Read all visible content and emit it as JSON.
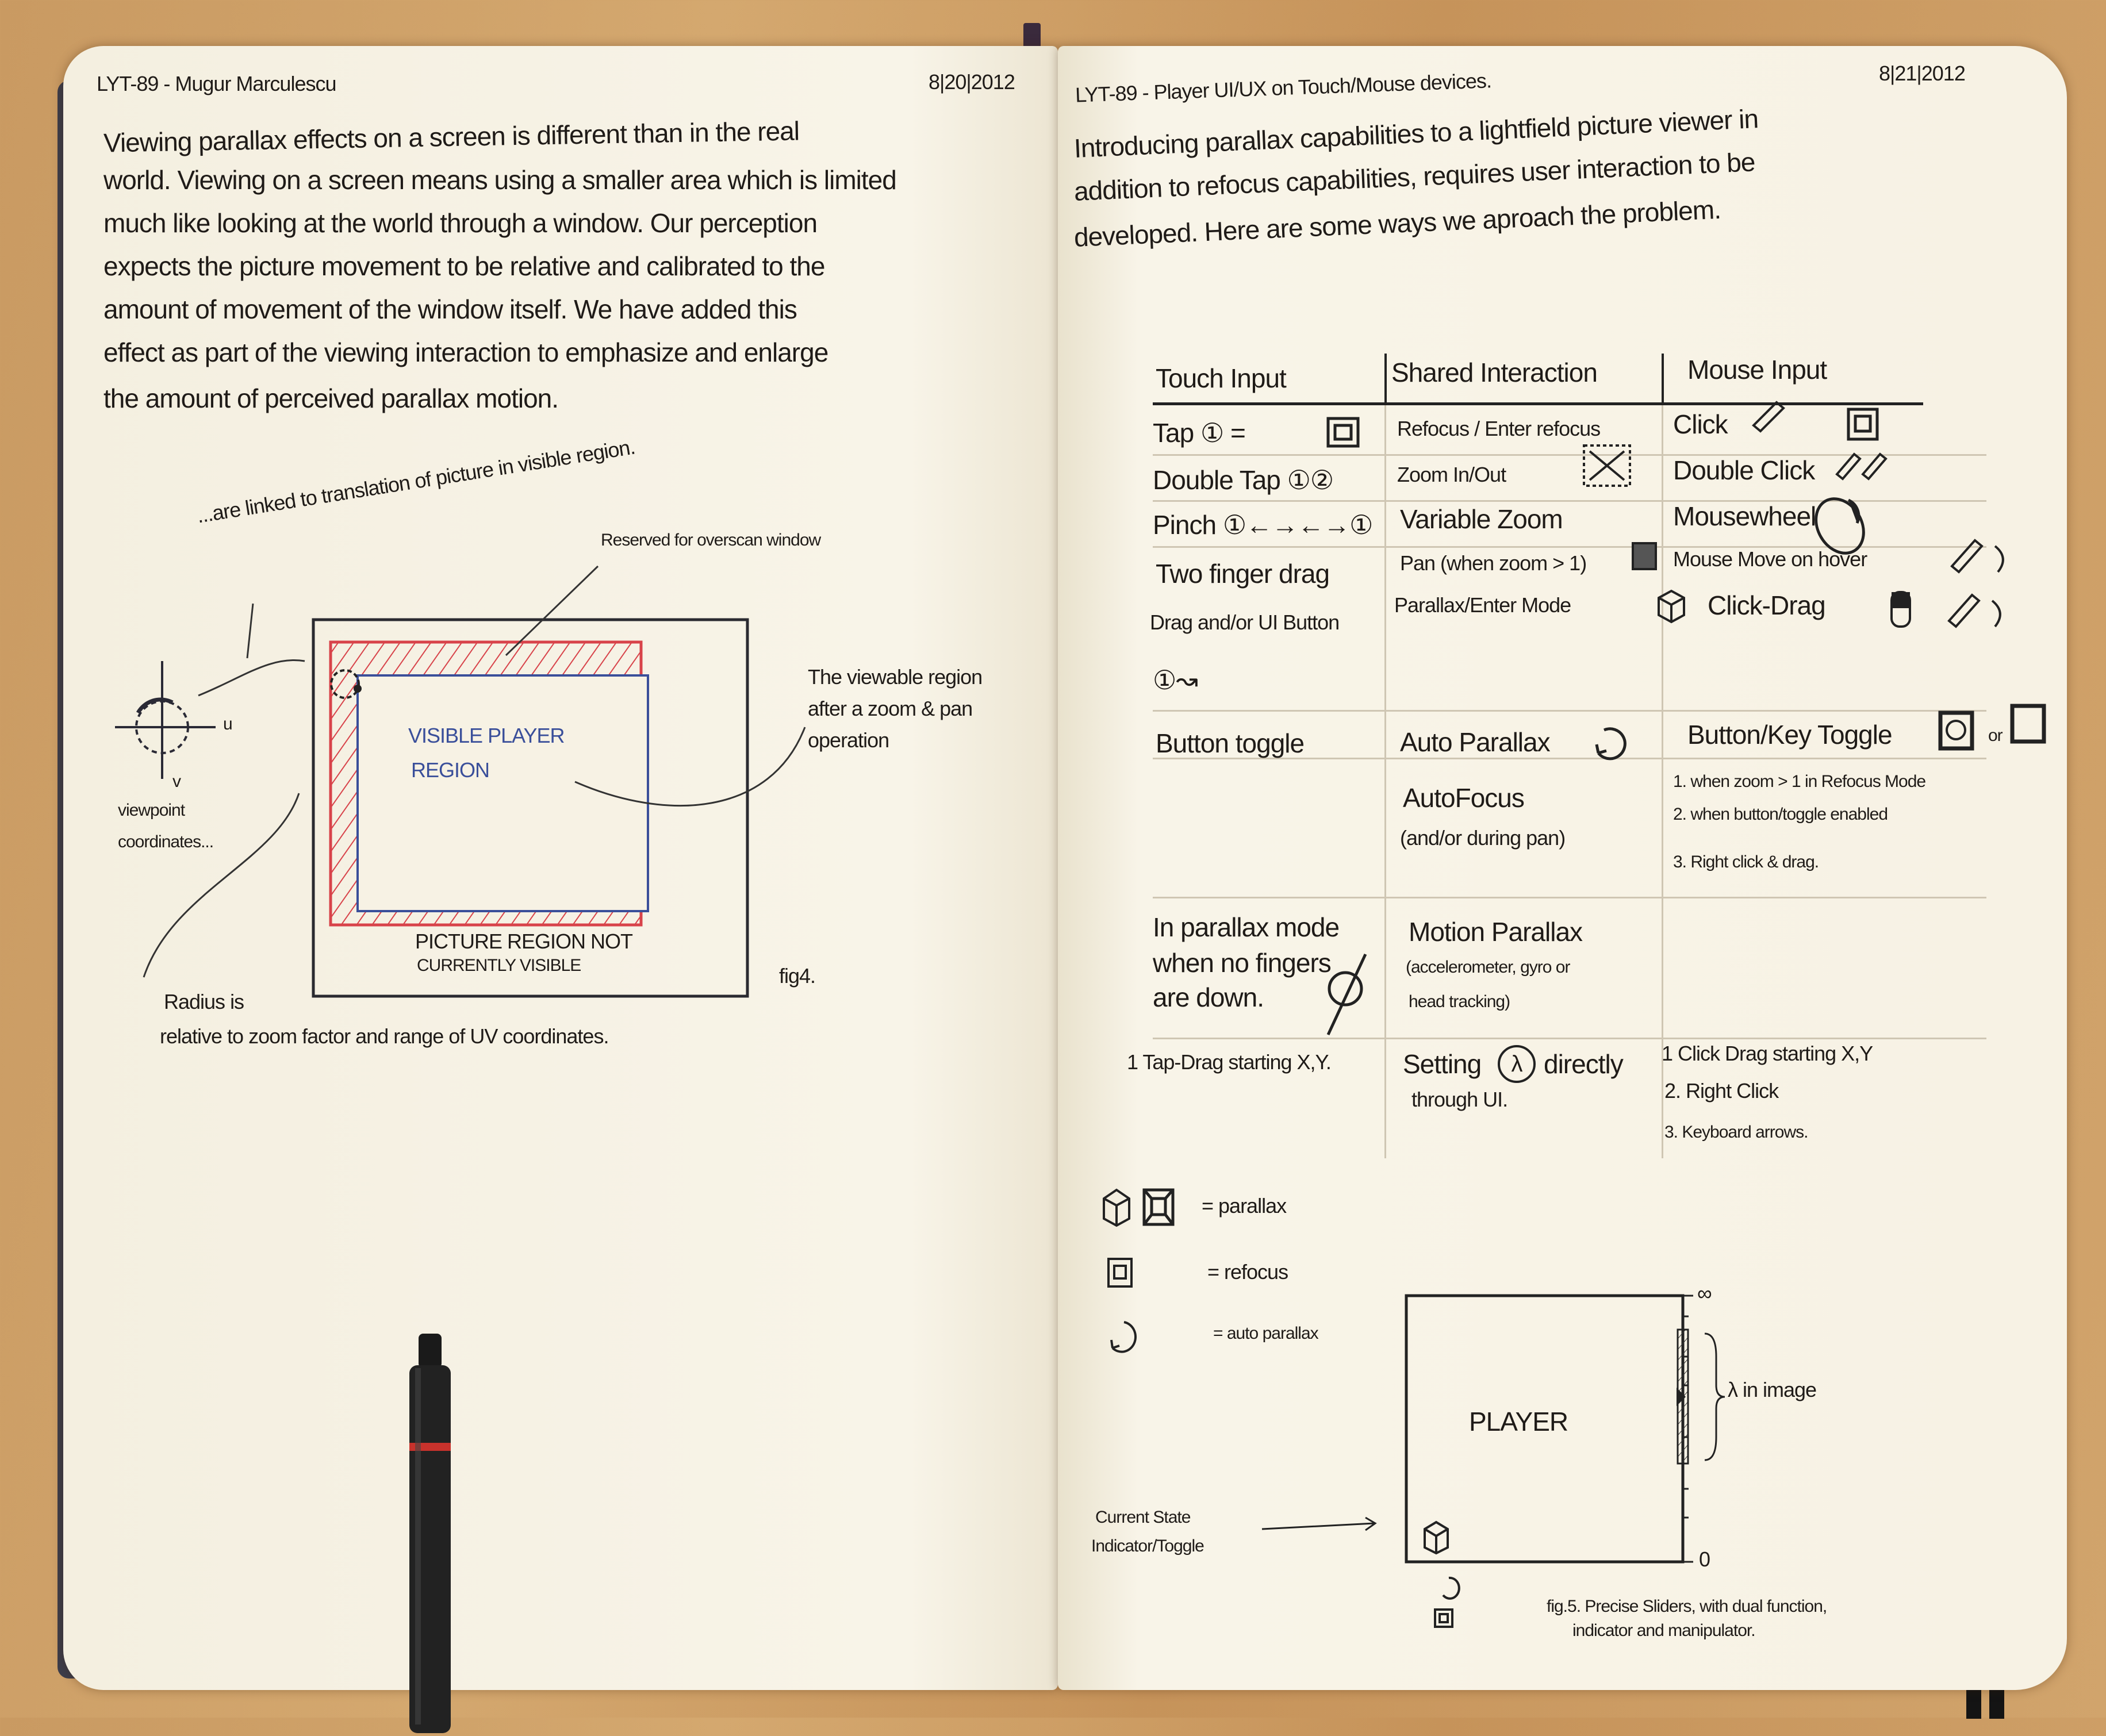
{
  "left_page": {
    "header": {
      "title": "LYT-89 - Mugur Marculescu",
      "date": "8|20|2012"
    },
    "paragraph_lines": [
      "Viewing parallax effects on a screen is different than in the real",
      "world. Viewing on a screen means using a smaller area which is limited",
      "much like looking at the world through a window. Our perception",
      "expects the picture movement to be relative and calibrated to the",
      "amount of movement of the window itself. We have added this",
      "effect as part of the viewing interaction to emphasize and enlarge",
      "the amount of perceived parallax motion."
    ],
    "figure4": {
      "linked_note": "...are linked to translation of picture in visible region.",
      "overscan_label": "Reserved for overscan window",
      "visible_region_lines": [
        "VISIBLE PLAYER",
        "REGION"
      ],
      "not_visible_lines": [
        "PICTURE REGION NOT",
        "CURRENTLY VISIBLE"
      ],
      "viewable_note_lines": [
        "The viewable region",
        "after a zoom & pan",
        "operation"
      ],
      "fig_label": "fig4.",
      "axis_u": "u",
      "axis_v": "v",
      "viewpoint_lines": [
        "viewpoint",
        "coordinates..."
      ],
      "radius_lines": [
        "Radius is",
        "relative to zoom factor and range of UV coordinates."
      ],
      "colors": {
        "overscan_hatch": "#d8434a",
        "visible_region": "#3a4f9a"
      }
    }
  },
  "right_page": {
    "header": {
      "title": "LYT-89 - Player UI/UX on Touch/Mouse devices.",
      "date": "8|21|2012"
    },
    "intro_lines": [
      "Introducing parallax capabilities to a lightfield picture viewer in",
      "addition to refocus capabilities, requires user interaction to be",
      "developed. Here are some ways we aproach the problem."
    ],
    "table": {
      "headers": [
        "Touch Input",
        "Shared Interaction",
        "Mouse Input"
      ],
      "touch": [
        "Tap ① =",
        "Double Tap ①②",
        "Pinch ①←→←→①",
        "Two finger drag",
        "Drag and/or UI Button",
        "①↝",
        "Button toggle",
        "In parallax mode",
        "when no fingers",
        "are down.",
        "1  Tap-Drag starting X,Y."
      ],
      "shared": [
        "Refocus / Enter refocus",
        "Zoom In/Out",
        "Variable Zoom",
        "Pan (when zoom > 1)",
        "Parallax/Enter Mode",
        "Auto Parallax",
        "AutoFocus",
        "(and/or during pan)",
        "Motion Parallax",
        "(accelerometer, gyro or",
        "head tracking)",
        "Setting",
        "directly",
        "through UI."
      ],
      "mouse": [
        "Click",
        "Double Click",
        "Mousewheel",
        "Mouse Move on hover",
        "Click-Drag",
        "Button/Key Toggle",
        "or",
        "1. when zoom > 1 in Refocus Mode",
        "2. when button/toggle enabled",
        "3. Right click & drag.",
        "1 Click Drag starting X,Y",
        "2. Right Click",
        "3. Keyboard arrows."
      ],
      "lambda_symbol": "λ"
    },
    "legend": [
      {
        "icons": [
          "cube-icon",
          "parallax-frame-icon"
        ],
        "label": "= parallax"
      },
      {
        "icons": [
          "refocus-icon"
        ],
        "label": "= refocus"
      },
      {
        "icons": [
          "auto-parallax-icon"
        ],
        "label": "= auto parallax"
      }
    ],
    "figure5": {
      "player_label": "PLAYER",
      "max_label": "∞",
      "min_label": "0",
      "lambda_label": "λ in image",
      "state_label_lines": [
        "Current State",
        "Indicator/Toggle"
      ],
      "caption_lines": [
        "fig.5. Precise Sliders, with dual function,",
        "indicator and manipulator."
      ]
    }
  }
}
